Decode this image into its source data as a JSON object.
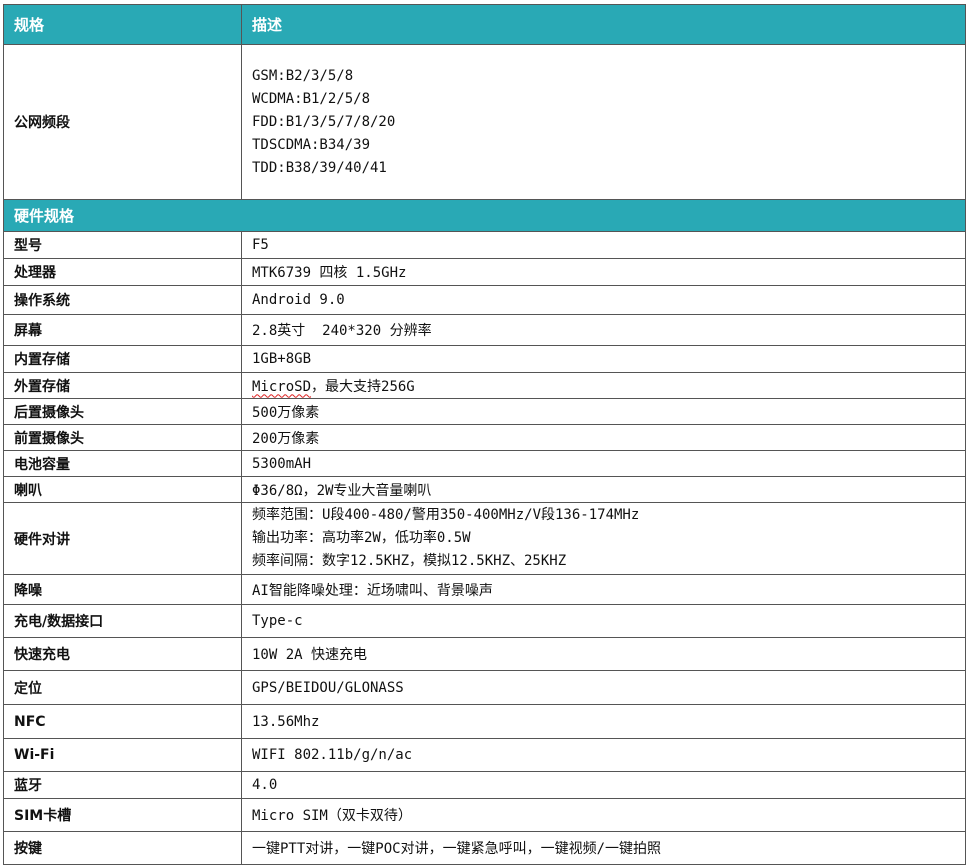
{
  "header": {
    "col1": "规格",
    "col2": "描述"
  },
  "network": {
    "label": "公网频段",
    "lines": [
      "GSM:B2/3/5/8",
      "WCDMA:B1/2/5/8",
      "FDD:B1/3/5/7/8/20",
      "TDSCDMA:B34/39",
      "TDD:B38/39/40/41"
    ]
  },
  "section_title": "硬件规格",
  "rows": {
    "model": {
      "label": "型号",
      "value": "F5"
    },
    "cpu": {
      "label": "处理器",
      "value": "MTK6739 四核 1.5GHz"
    },
    "os": {
      "label": "操作系统",
      "value": "Android 9.0"
    },
    "screen": {
      "label": "屏幕",
      "value": "2.8英寸  240*320 分辨率"
    },
    "storage": {
      "label": "内置存储",
      "value": "1GB+8GB"
    },
    "ext_storage": {
      "label": "外置存储",
      "value_a": "MicroSD",
      "value_b": "，最大支持256G"
    },
    "rear_cam": {
      "label": "后置摄像头",
      "value": "500万像素"
    },
    "front_cam": {
      "label": "前置摄像头",
      "value": "200万像素"
    },
    "battery": {
      "label": "电池容量",
      "value": "5300mAH"
    },
    "speaker": {
      "label": "喇叭",
      "value": "Φ36/8Ω，2W专业大音量喇叭"
    },
    "intercom": {
      "label": "硬件对讲",
      "lines": [
        "频率范围：U段400-480/警用350-400MHz/V段136-174MHz",
        "输出功率：高功率2W，低功率0.5W",
        "频率间隔：数字12.5KHZ，模拟12.5KHZ、25KHZ"
      ]
    },
    "noise": {
      "label": "降噪",
      "value": "AI智能降噪处理：近场啸叫、背景噪声"
    },
    "port": {
      "label": "充电/数据接口",
      "value": "Type-c"
    },
    "fast_charge": {
      "label": "快速充电",
      "value": "10W 2A 快速充电"
    },
    "gps": {
      "label": "定位",
      "value": "GPS/BEIDOU/GLONASS"
    },
    "nfc": {
      "label": "NFC",
      "value": "13.56Mhz"
    },
    "wifi": {
      "label": "Wi-Fi",
      "value": "WIFI 802.11b/g/n/ac"
    },
    "bt": {
      "label": "蓝牙",
      "value": "4.0"
    },
    "sim": {
      "label": "SIM卡槽",
      "value": "Micro SIM（双卡双待）"
    },
    "keys": {
      "label": "按键",
      "value": "一键PTT对讲，一键POC对讲，一键紧急呼叫，一键视频/一键拍照"
    }
  }
}
